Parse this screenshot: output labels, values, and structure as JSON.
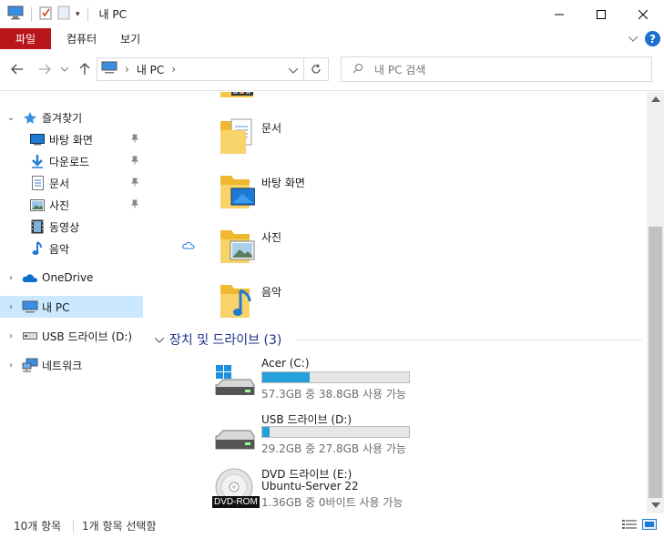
{
  "window": {
    "title": "내 PC"
  },
  "ribbon": {
    "tabs": [
      "파일",
      "컴퓨터",
      "보기"
    ]
  },
  "nav": {
    "breadcrumb": [
      "내 PC"
    ],
    "search_placeholder": "내 PC 검색"
  },
  "sidebar": {
    "quick_access": "즐겨찾기",
    "quick_items": [
      {
        "label": "바탕 화면",
        "pinned": true
      },
      {
        "label": "다운로드",
        "pinned": true
      },
      {
        "label": "문서",
        "pinned": true
      },
      {
        "label": "사진",
        "pinned": true
      },
      {
        "label": "동영상",
        "pinned": false
      },
      {
        "label": "음악",
        "pinned": false
      }
    ],
    "onedrive": "OneDrive",
    "this_pc": "내 PC",
    "usb": "USB 드라이브 (D:)",
    "network": "네트워크"
  },
  "folders": [
    "문서",
    "바탕 화면",
    "사진",
    "음악"
  ],
  "drives_group": {
    "title": "장치 및 드라이브 (3)"
  },
  "drives": [
    {
      "name": "Acer (C:)",
      "free": "57.3GB 중 38.8GB 사용 가능",
      "used_fraction": 0.32
    },
    {
      "name": "USB 드라이브 (D:)",
      "free": "29.2GB 중 27.8GB 사용 가능",
      "used_fraction": 0.05
    },
    {
      "name": "DVD 드라이브 (E:)",
      "label2": "Ubuntu-Server 22",
      "free": "1.36GB 중 0바이트 사용 가능",
      "badge": "DVD-ROM"
    }
  ],
  "status": {
    "item_count": "10개 항목",
    "selected": "1개 항목 선택함"
  },
  "colors": {
    "file_tab": "#b9161c",
    "selection": "#cce8ff",
    "drive_fill": "#26a0da",
    "group_title": "#1e3287"
  }
}
